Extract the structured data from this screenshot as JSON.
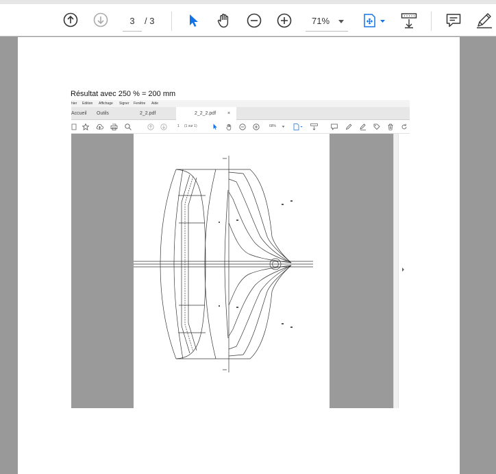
{
  "toolbar": {
    "current_page": "3",
    "page_total": "/ 3",
    "zoom": "71%",
    "accent_color": "#1473e6"
  },
  "document": {
    "caption": "Résultat avec 250 % = 200 mm",
    "screenshot": {
      "menu": [
        "hier",
        "Edition",
        "Affichage",
        "Signer",
        "Fenêtre",
        "Aide"
      ],
      "tabs": [
        "Accueil",
        "Outils",
        "2_2.pdf",
        "2_2_2.pdf"
      ],
      "tab_close": "×",
      "page_indicator": "1",
      "page_of": "(1 sur 1)",
      "zoom": "68%"
    }
  }
}
